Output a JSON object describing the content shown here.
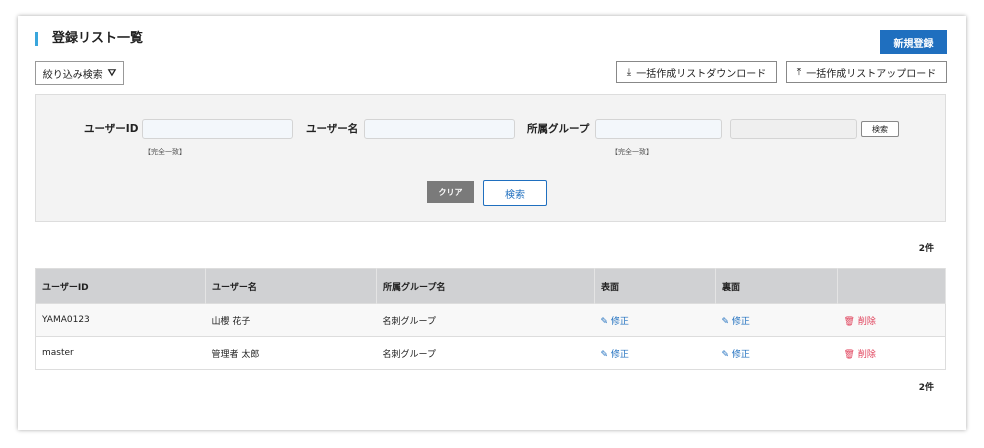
{
  "page": {
    "title": "登録リスト一覧",
    "new_button": "新規登録",
    "filter_button": "絞り込み検索",
    "download_button": "一括作成リストダウンロード",
    "upload_button": "一括作成リストアップロード"
  },
  "search": {
    "user_id_label": "ユーザーID",
    "user_id_value": "",
    "user_id_hint": "【完全一致】",
    "user_name_label": "ユーザー名",
    "user_name_value": "",
    "group_label": "所属グループ",
    "group_value": "",
    "group_hint": "【完全一致】",
    "group_search_button": "検索",
    "clear_button": "クリア",
    "search_button": "検索"
  },
  "count_top": "2件",
  "count_bottom": "2件",
  "table": {
    "headers": [
      "ユーザーID",
      "ユーザー名",
      "所属グループ名",
      "表面",
      "裏面",
      ""
    ],
    "rows": [
      {
        "id": "YAMA0123",
        "name": "山櫻 花子",
        "group": "名刺グループ",
        "front": "修正",
        "back": "修正",
        "delete": "削除"
      },
      {
        "id": "master",
        "name": "管理者 太郎",
        "group": "名刺グループ",
        "front": "修正",
        "back": "修正",
        "delete": "削除"
      }
    ]
  },
  "colors": {
    "accent": "#1f6fbf",
    "title_bar": "#3aa6dc",
    "delete": "#e0405a"
  }
}
